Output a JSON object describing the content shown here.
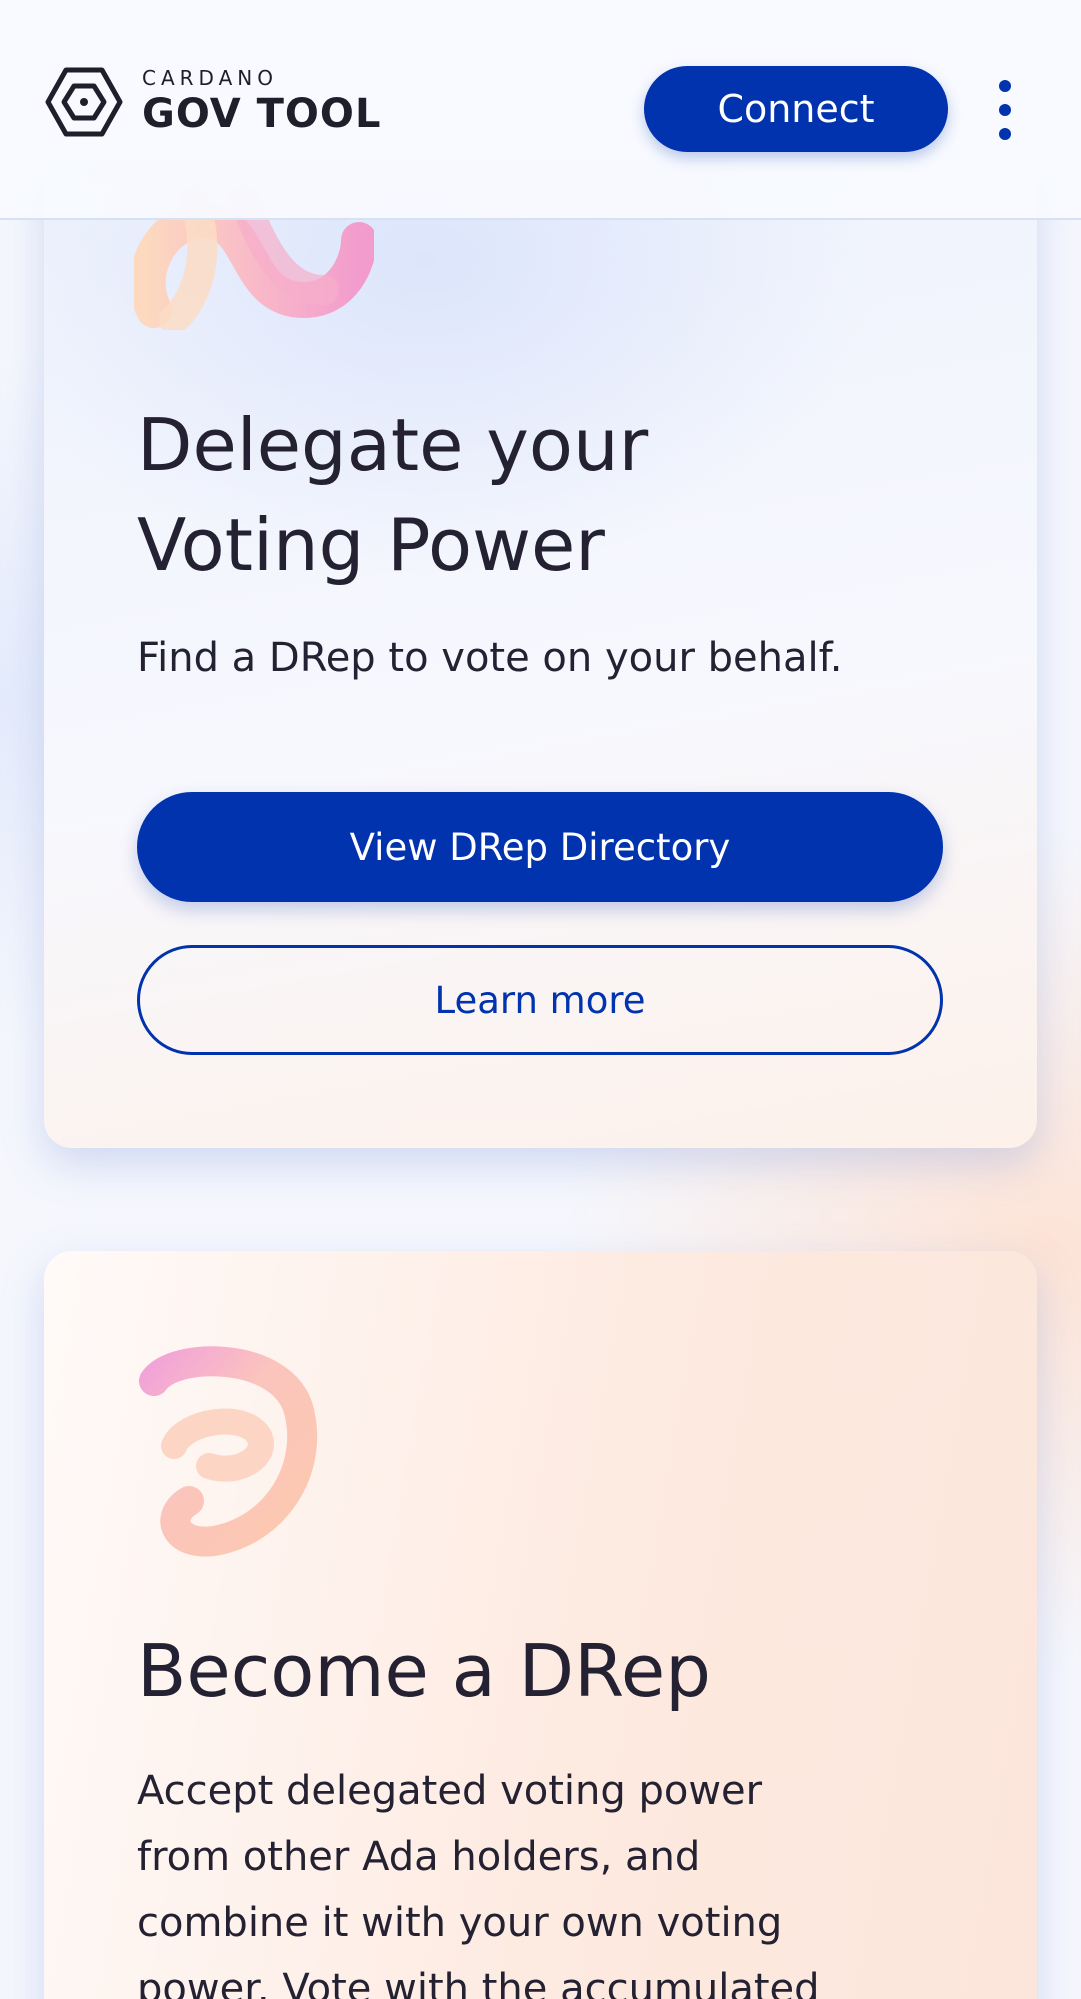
{
  "header": {
    "logo_top": "CARDANO",
    "logo_bottom": "GOV TOOL",
    "connect_label": "Connect",
    "menu_icon": "more-vertical-icon"
  },
  "delegate_card": {
    "title_line1": "Delegate your",
    "title_line2": "Voting Power",
    "description": "Find a DRep to vote on your behalf.",
    "primary_button": "View DRep Directory",
    "secondary_button": "Learn more"
  },
  "drep_card": {
    "title": "Become a DRep",
    "description_lines": [
      "Accept delegated voting power",
      "from other Ada holders, and",
      "combine it with your own voting",
      "power. Vote with the accumulated"
    ]
  },
  "colors": {
    "brand_blue": "#0033ad",
    "text_dark": "#242232"
  }
}
